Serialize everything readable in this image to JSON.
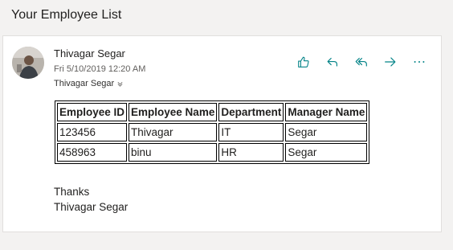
{
  "subject": "Your Employee List",
  "message": {
    "sender": "Thivagar Segar",
    "date": "Fri 5/10/2019 12:20 AM",
    "recipient": "Thivagar Segar",
    "closing_line1": "Thanks",
    "closing_line2": "Thivagar Segar"
  },
  "actions": {
    "like_icon": "thumbs-up-icon",
    "reply_icon": "reply-icon",
    "reply_all_icon": "reply-all-icon",
    "forward_icon": "forward-icon",
    "more_icon": "more-icon"
  },
  "table": {
    "headers": [
      "Employee ID",
      "Employee Name",
      "Department",
      "Manager Name"
    ],
    "rows": [
      [
        "123456",
        "Thivagar",
        "IT",
        "Segar"
      ],
      [
        "458963",
        "binu",
        "HR",
        "Segar"
      ]
    ]
  },
  "colors": {
    "accent": "#038387",
    "background": "#f3f2f1",
    "card": "#ffffff"
  }
}
